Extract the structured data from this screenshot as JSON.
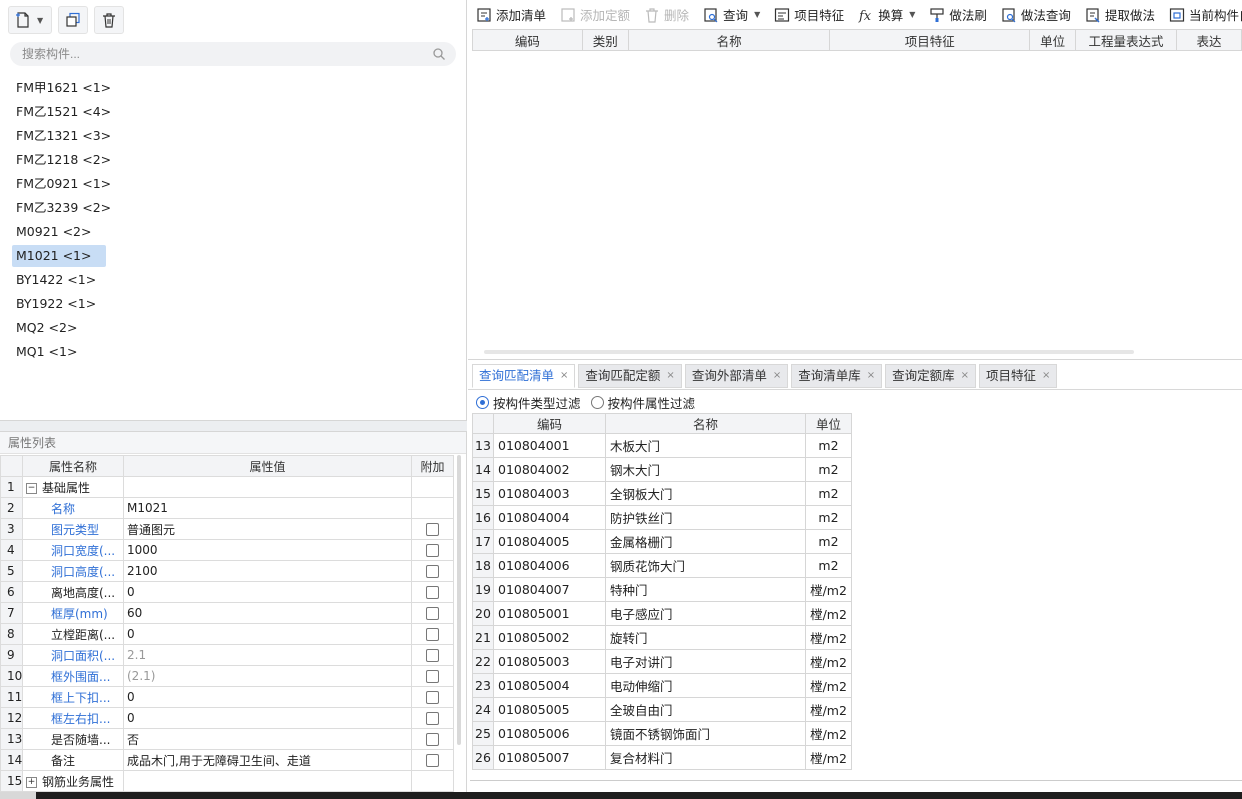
{
  "left_toolbar": {
    "icons": [
      "new-icon",
      "copy-icon",
      "delete-icon"
    ]
  },
  "search": {
    "placeholder": "搜索构件..."
  },
  "components": [
    {
      "label": "FM甲1621 <1>"
    },
    {
      "label": "FM乙1521 <4>"
    },
    {
      "label": "FM乙1321 <3>"
    },
    {
      "label": "FM乙1218 <2>"
    },
    {
      "label": "FM乙0921 <1>"
    },
    {
      "label": "FM乙3239 <2>"
    },
    {
      "label": "M0921 <2>"
    },
    {
      "label": "M1021 <1>",
      "selected": true
    },
    {
      "label": "BY1422 <1>"
    },
    {
      "label": "BY1922 <1>"
    },
    {
      "label": "MQ2 <2>"
    },
    {
      "label": "MQ1 <1>"
    }
  ],
  "props": {
    "title": "属性列表",
    "headers": {
      "name": "属性名称",
      "value": "属性值",
      "extra": "附加"
    },
    "rows": [
      {
        "num": "1",
        "name": "基础属性",
        "value": "",
        "group": true,
        "expander": "−"
      },
      {
        "num": "2",
        "name": "名称",
        "value": "M1021",
        "blue": true
      },
      {
        "num": "3",
        "name": "图元类型",
        "value": "普通图元",
        "blue": true,
        "check": true
      },
      {
        "num": "4",
        "name": "洞口宽度(...",
        "value": "1000",
        "blue": true,
        "check": true
      },
      {
        "num": "5",
        "name": "洞口高度(...",
        "value": "2100",
        "blue": true,
        "check": true
      },
      {
        "num": "6",
        "name": "离地高度(...",
        "value": "0",
        "check": true
      },
      {
        "num": "7",
        "name": "框厚(mm)",
        "value": "60",
        "blue": true,
        "check": true
      },
      {
        "num": "8",
        "name": "立樘距离(...",
        "value": "0",
        "check": true
      },
      {
        "num": "9",
        "name": "洞口面积(...",
        "value": "2.1",
        "blue": true,
        "grayval": true,
        "check": true
      },
      {
        "num": "10",
        "name": "框外围面...",
        "value": "(2.1)",
        "blue": true,
        "grayval": true,
        "check": true
      },
      {
        "num": "11",
        "name": "框上下扣...",
        "value": "0",
        "blue": true,
        "check": true
      },
      {
        "num": "12",
        "name": "框左右扣...",
        "value": "0",
        "blue": true,
        "check": true
      },
      {
        "num": "13",
        "name": "是否随墙...",
        "value": "否",
        "check": true
      },
      {
        "num": "14",
        "name": "备注",
        "value": "成品木门,用于无障碍卫生间、走道",
        "check": true
      },
      {
        "num": "15",
        "name": "钢筋业务属性",
        "value": "",
        "group": true,
        "expander": "+"
      }
    ]
  },
  "toolbar": [
    {
      "label": "添加清单",
      "icon": "add-list-icon"
    },
    {
      "label": "添加定额",
      "icon": "add-quota-icon",
      "disabled": true
    },
    {
      "label": "删除",
      "icon": "delete-icon",
      "disabled": true
    },
    {
      "label": "查询",
      "icon": "query-icon",
      "dropdown": true
    },
    {
      "label": "项目特征",
      "icon": "feature-icon"
    },
    {
      "label": "换算",
      "icon": "fx-icon",
      "dropdown": true
    },
    {
      "label": "做法刷",
      "icon": "brush-icon"
    },
    {
      "label": "做法查询",
      "icon": "method-query-icon"
    },
    {
      "label": "提取做法",
      "icon": "extract-icon"
    },
    {
      "label": "当前构件自动",
      "icon": "auto-icon"
    }
  ],
  "grid_headers": [
    "编码",
    "类别",
    "名称",
    "项目特征",
    "单位",
    "工程量表达式",
    "表达"
  ],
  "tabs": [
    {
      "label": "查询匹配清单",
      "active": true
    },
    {
      "label": "查询匹配定额"
    },
    {
      "label": "查询外部清单"
    },
    {
      "label": "查询清单库"
    },
    {
      "label": "查询定额库"
    },
    {
      "label": "项目特征"
    }
  ],
  "filters": [
    {
      "label": "按构件类型过滤",
      "checked": true
    },
    {
      "label": "按构件属性过滤",
      "checked": false
    }
  ],
  "query_headers": {
    "code": "编码",
    "name": "名称",
    "unit": "单位"
  },
  "query_rows": [
    {
      "num": "13",
      "code": "010804001",
      "name": "木板大门",
      "unit": "m2"
    },
    {
      "num": "14",
      "code": "010804002",
      "name": "钢木大门",
      "unit": "m2"
    },
    {
      "num": "15",
      "code": "010804003",
      "name": "全钢板大门",
      "unit": "m2"
    },
    {
      "num": "16",
      "code": "010804004",
      "name": "防护铁丝门",
      "unit": "m2"
    },
    {
      "num": "17",
      "code": "010804005",
      "name": "金属格栅门",
      "unit": "m2"
    },
    {
      "num": "18",
      "code": "010804006",
      "name": "钢质花饰大门",
      "unit": "m2"
    },
    {
      "num": "19",
      "code": "010804007",
      "name": "特种门",
      "unit": "樘/m2"
    },
    {
      "num": "20",
      "code": "010805001",
      "name": "电子感应门",
      "unit": "樘/m2"
    },
    {
      "num": "21",
      "code": "010805002",
      "name": "旋转门",
      "unit": "樘/m2"
    },
    {
      "num": "22",
      "code": "010805003",
      "name": "电子对讲门",
      "unit": "樘/m2"
    },
    {
      "num": "23",
      "code": "010805004",
      "name": "电动伸缩门",
      "unit": "樘/m2"
    },
    {
      "num": "24",
      "code": "010805005",
      "name": "全玻自由门",
      "unit": "樘/m2"
    },
    {
      "num": "25",
      "code": "010805006",
      "name": "镜面不锈钢饰面门",
      "unit": "樘/m2"
    },
    {
      "num": "26",
      "code": "010805007",
      "name": "复合材料门",
      "unit": "樘/m2"
    }
  ],
  "colors": {
    "accent": "#2f6fd6",
    "selected": "#c8ddf5",
    "header": "#f3f4f6"
  }
}
